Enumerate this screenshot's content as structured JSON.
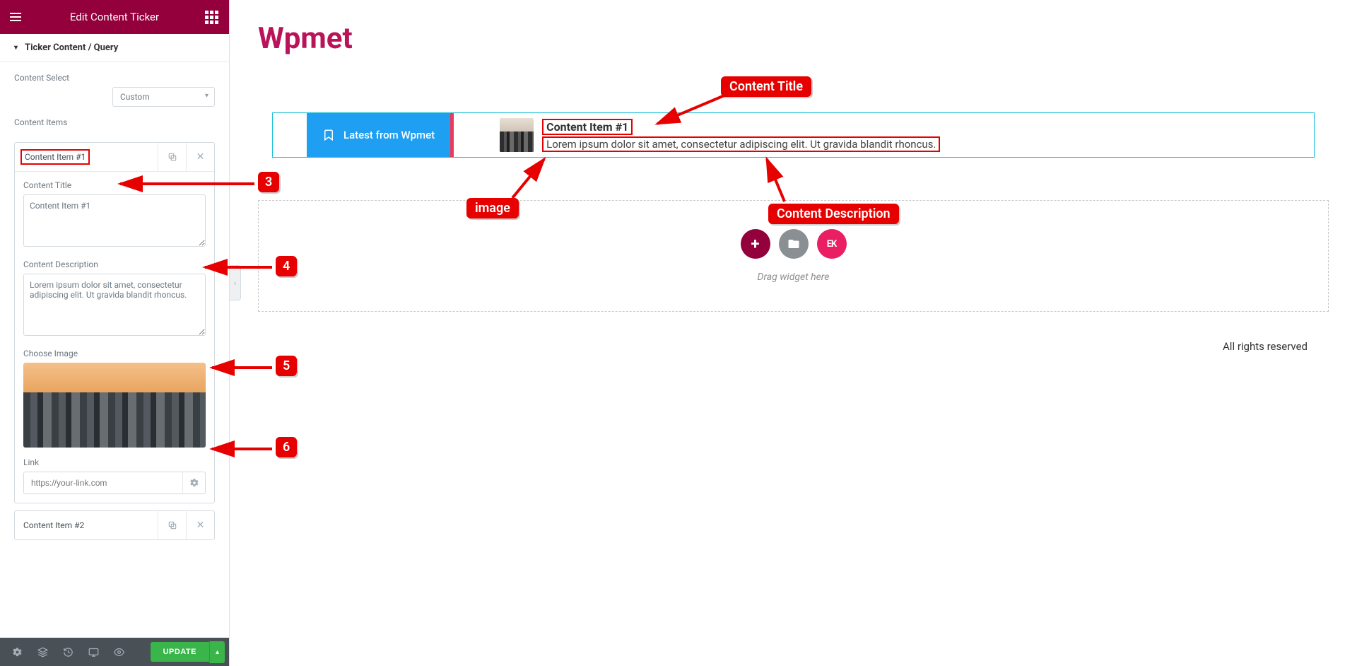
{
  "panel": {
    "header_title": "Edit Content Ticker",
    "section_title": "Ticker Content / Query",
    "content_select_label": "Content Select",
    "content_select_value": "Custom",
    "content_items_label": "Content Items",
    "item1_title": "Content Item #1",
    "item2_title": "Content Item #2",
    "content_title_label": "Content Title",
    "content_title_value": "Content Item #1",
    "content_desc_label": "Content Description",
    "content_desc_value": "Lorem ipsum dolor sit amet, consectetur adipiscing elit. Ut gravida blandit rhoncus.",
    "choose_image_label": "Choose Image",
    "link_label": "Link",
    "link_placeholder": "https://your-link.com",
    "update_button": "UPDATE"
  },
  "canvas": {
    "site_title": "Wpmet",
    "ticker_badge": "Latest from Wpmet",
    "ticker_item_title": "Content Item #1",
    "ticker_item_desc": "Lorem ipsum dolor sit amet, consectetur adipiscing elit. Ut gravida blandit rhoncus.",
    "ek_label": "EK",
    "dropzone_hint": "Drag widget here",
    "footer": "All rights reserved"
  },
  "annotations": {
    "content_title": "Content Title",
    "image": "image",
    "content_description": "Content Description",
    "n3": "3",
    "n4": "4",
    "n5": "5",
    "n6": "6"
  }
}
